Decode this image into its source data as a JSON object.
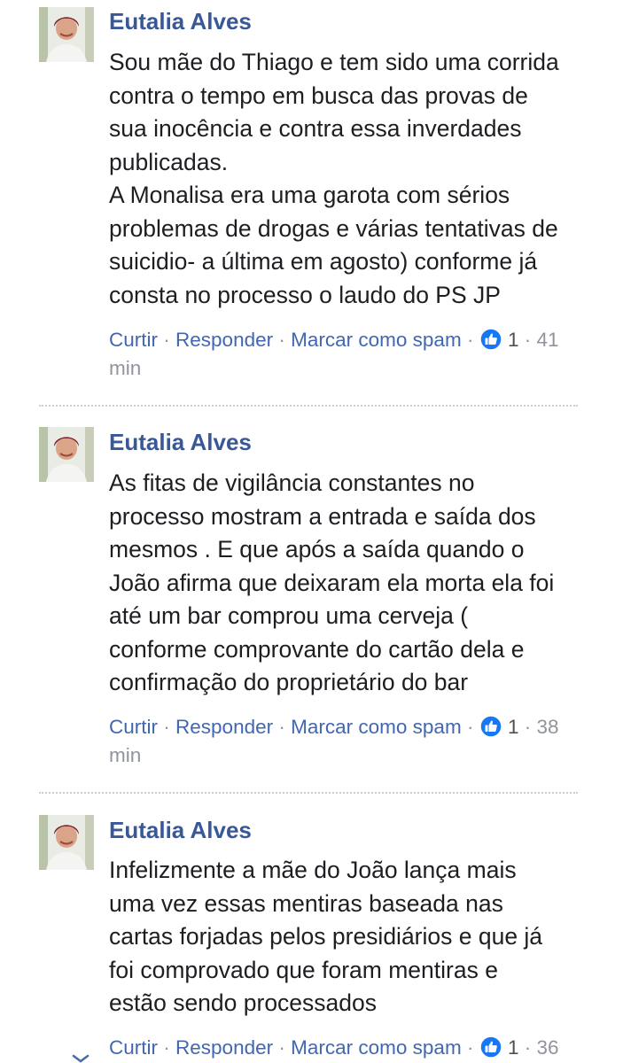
{
  "comments": [
    {
      "author": "Eutalia Alves",
      "lines": [
        "Sou mãe do Thiago e tem sido uma corrida",
        "contra o tempo em busca das provas de",
        "sua inocência e contra essa inverdades",
        "publicadas.",
        "A Monalisa era uma garota com sérios",
        "problemas de drogas e várias tentativas de",
        "suicidio- a última em agosto) conforme já",
        "consta no processo o laudo do PS JP"
      ],
      "like_label": "Curtir",
      "reply_label": "Responder",
      "spam_label": "Marcar como spam",
      "reactions": "1",
      "time_a": "41",
      "time_b": "min"
    },
    {
      "author": "Eutalia Alves",
      "lines": [
        "As fitas de vigilância constantes no",
        "processo mostram a entrada e saída dos",
        "mesmos . E que após a saída quando o",
        "João afirma que deixaram ela morta ela foi",
        "até um bar comprou uma cerveja (",
        "conforme comprovante do cartão dela e",
        "confirmação do proprietário do bar"
      ],
      "like_label": "Curtir",
      "reply_label": "Responder",
      "spam_label": "Marcar como spam",
      "reactions": "1",
      "time_a": "38",
      "time_b": "min"
    },
    {
      "author": "Eutalia Alves",
      "lines": [
        "Infelizmente a mãe do João lança mais",
        "uma vez essas mentiras baseada nas",
        "cartas forjadas pelos presidiários e que já",
        "foi comprovado que foram mentiras e",
        "estão sendo processados"
      ],
      "like_label": "Curtir",
      "reply_label": "Responder",
      "spam_label": "Marcar como spam",
      "reactions": "1",
      "time_a": "36",
      "time_b": ""
    }
  ],
  "separator": "·",
  "icons": {
    "avatar": "profile-photo",
    "reaction": "thumbs-up-icon",
    "peek": "chevron-down-icon"
  },
  "colors": {
    "author": "#385898",
    "link": "#4267b2",
    "meta": "#90949c",
    "reaction_badge": "#1877f2",
    "text": "#1c1e21"
  }
}
